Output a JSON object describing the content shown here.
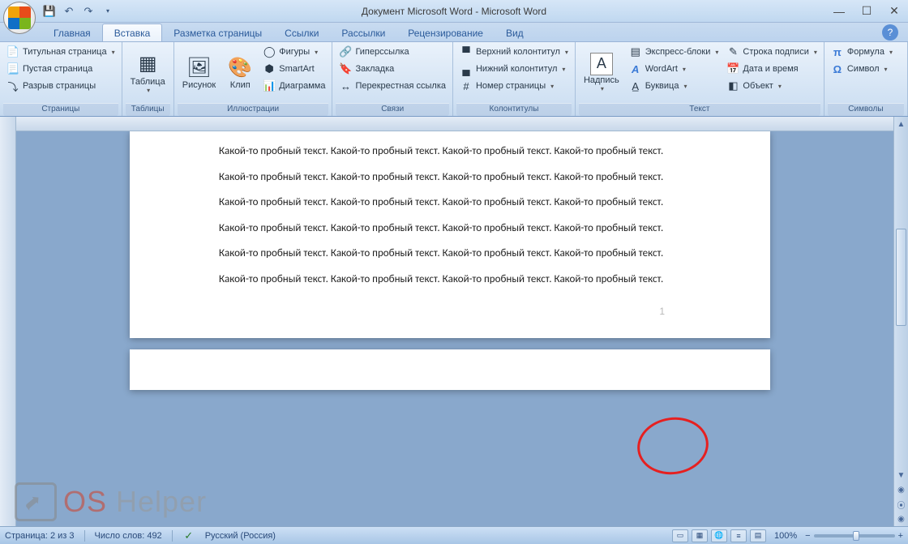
{
  "title": "Документ Microsoft Word - Microsoft Word",
  "tabs": {
    "home": "Главная",
    "insert": "Вставка",
    "layout": "Разметка страницы",
    "refs": "Ссылки",
    "mail": "Рассылки",
    "review": "Рецензирование",
    "view": "Вид"
  },
  "ribbon": {
    "pages": {
      "title_page": "Титульная страница",
      "blank_page": "Пустая страница",
      "page_break": "Разрыв страницы",
      "group": "Страницы"
    },
    "tables": {
      "table": "Таблица",
      "group": "Таблицы"
    },
    "illus": {
      "picture": "Рисунок",
      "clip": "Клип",
      "shapes": "Фигуры",
      "smartart": "SmartArt",
      "chart": "Диаграмма",
      "group": "Иллюстрации"
    },
    "links": {
      "hyperlink": "Гиперссылка",
      "bookmark": "Закладка",
      "crossref": "Перекрестная ссылка",
      "group": "Связи"
    },
    "headers": {
      "header": "Верхний колонтитул",
      "footer": "Нижний колонтитул",
      "pagenum": "Номер страницы",
      "group": "Колонтитулы"
    },
    "text": {
      "textbox": "Надпись",
      "quickparts": "Экспресс-блоки",
      "wordart": "WordArt",
      "dropcap": "Буквица",
      "sigline": "Строка подписи",
      "datetime": "Дата и время",
      "object": "Объект",
      "group": "Текст"
    },
    "symbols": {
      "equation": "Формула",
      "symbol": "Символ",
      "group": "Символы"
    }
  },
  "doc": {
    "paragraph": "Какой-то пробный текст. Какой-то пробный текст. Какой-то пробный текст. Какой-то пробный текст.",
    "page_number": "1"
  },
  "status": {
    "page": "Страница: 2 из 3",
    "words": "Число слов: 492",
    "lang": "Русский (Россия)",
    "zoom": "100%"
  },
  "watermark": {
    "os": "OS",
    "helper": " Helper"
  }
}
